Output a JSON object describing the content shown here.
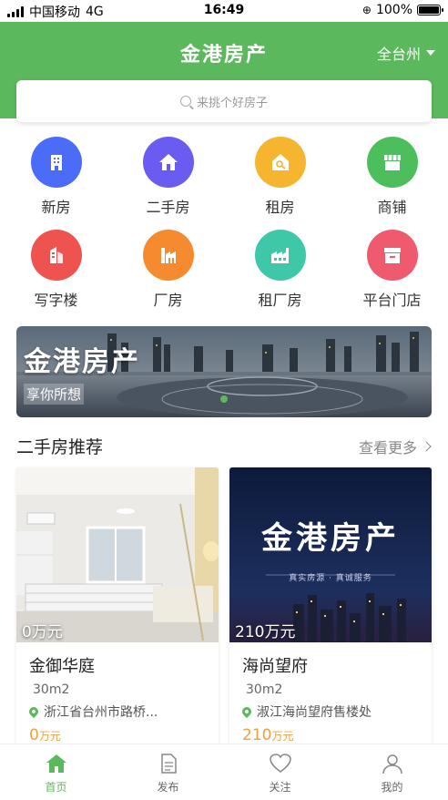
{
  "status_bar": {
    "carrier": "中国移动",
    "network": "4G",
    "time": "16:49",
    "battery": "100%"
  },
  "header": {
    "title": "金港房产",
    "city": "全台州",
    "search_placeholder": "来挑个好房子"
  },
  "categories": [
    {
      "label": "新房",
      "icon": "building-icon",
      "color": "#4a6cf7"
    },
    {
      "label": "二手房",
      "icon": "house-icon",
      "color": "#6a5cf0"
    },
    {
      "label": "租房",
      "icon": "key-house-icon",
      "color": "#f5b52e"
    },
    {
      "label": "商铺",
      "icon": "shop-icon",
      "color": "#4cbf5c"
    },
    {
      "label": "写字楼",
      "icon": "office-icon",
      "color": "#ef5350"
    },
    {
      "label": "厂房",
      "icon": "factory-building-icon",
      "color": "#f58a2e"
    },
    {
      "label": "租厂房",
      "icon": "factory-icon",
      "color": "#3ec8a8"
    },
    {
      "label": "平台门店",
      "icon": "store-icon",
      "color": "#ef5a6e"
    }
  ],
  "banner": {
    "title": "金港房产",
    "subtitle": "享你所想"
  },
  "section": {
    "title": "二手房推荐",
    "more": "查看更多"
  },
  "listings": [
    {
      "image_price": "0万元",
      "name": "金御华庭",
      "area": "30m2",
      "address": "浙江省台州市路桥...",
      "price_value": "0",
      "price_unit": "万元"
    },
    {
      "image_price": "210万元",
      "name": "海尚望府",
      "area": "30m2",
      "address": "淑江海尚望府售楼处",
      "price_value": "210",
      "price_unit": "万元",
      "image_title": "金港房产",
      "image_slogan": "真实房源 · 真诚服务"
    }
  ],
  "tabs": [
    {
      "label": "首页",
      "icon": "home-icon",
      "active": true
    },
    {
      "label": "发布",
      "icon": "document-icon",
      "active": false
    },
    {
      "label": "关注",
      "icon": "heart-icon",
      "active": false
    },
    {
      "label": "我的",
      "icon": "user-icon",
      "active": false
    }
  ],
  "colors": {
    "brand": "#5cb85c",
    "price": "#f0a040"
  }
}
